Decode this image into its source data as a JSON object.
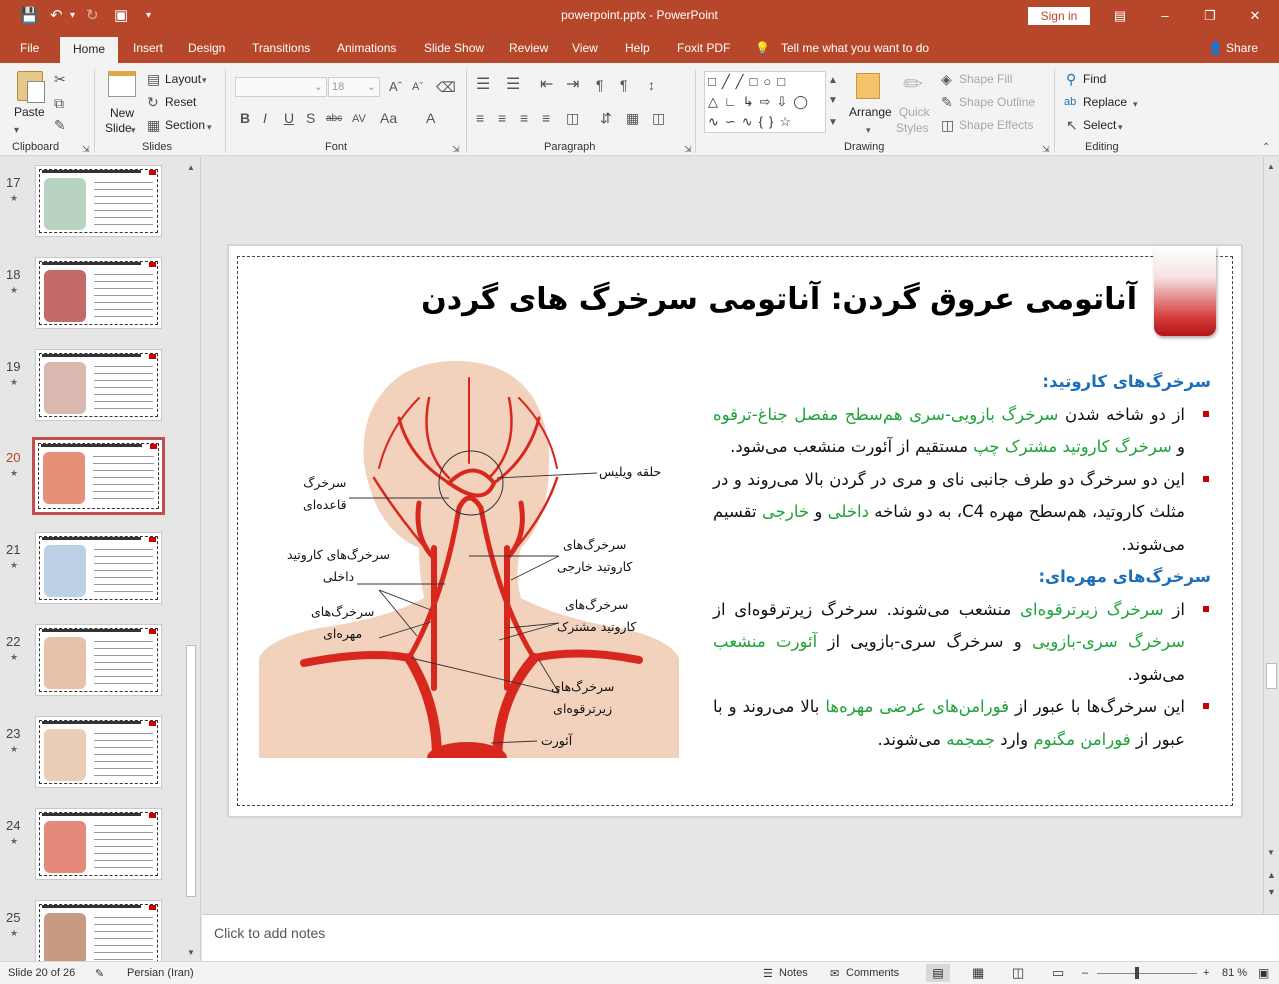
{
  "app": {
    "doc_title": "powerpoint.pptx  -  PowerPoint",
    "signin": "Sign in"
  },
  "menu": [
    "File",
    "Home",
    "Insert",
    "Design",
    "Transitions",
    "Animations",
    "Slide Show",
    "Review",
    "View",
    "Help",
    "Foxit PDF"
  ],
  "tell_me": "Tell me what you want to do",
  "share": "Share",
  "ribbon": {
    "clipboard": {
      "label": "Clipboard",
      "paste": "Paste"
    },
    "slides": {
      "label": "Slides",
      "new_slide_1": "New",
      "new_slide_2": "Slide",
      "layout": "Layout",
      "reset": "Reset",
      "section": "Section"
    },
    "font": {
      "label": "Font",
      "size": "18"
    },
    "paragraph": {
      "label": "Paragraph"
    },
    "drawing": {
      "label": "Drawing",
      "arrange": "Arrange",
      "quick_styles_1": "Quick",
      "quick_styles_2": "Styles",
      "shape_fill": "Shape Fill",
      "shape_outline": "Shape Outline",
      "shape_effects": "Shape Effects"
    },
    "editing": {
      "label": "Editing",
      "find": "Find",
      "replace": "Replace",
      "select": "Select"
    }
  },
  "thumbnails": [
    {
      "num": "17"
    },
    {
      "num": "18"
    },
    {
      "num": "19"
    },
    {
      "num": "20",
      "active": true
    },
    {
      "num": "21"
    },
    {
      "num": "22"
    },
    {
      "num": "23"
    },
    {
      "num": "24"
    },
    {
      "num": "25"
    }
  ],
  "slide": {
    "title": "آناتومی عروق گردن: آناتومی سرخرگ های گردن",
    "heading1": "سرخرگ‌های کاروتید:",
    "heading2": "سرخرگ‌های مهره‌ای:",
    "p1": {
      "a": "از دو شاخه شدن ",
      "b": "سرخرگ بازویی-سری هم‌سطح مفصل جناغ-ترقوه",
      "c": " و ",
      "d": "سرخرگ کاروتید مشترک چپ",
      "e": " مستقیم از آئورت منشعب می‌شود."
    },
    "p2": {
      "a": "این دو سرخرگ دو طرف جانبی نای و مری در گردن بالا می‌روند و در مثلث کاروتید، هم‌سطح مهره C4، به دو شاخه ",
      "b": "داخلی",
      "c": " و ",
      "d": "خارجی",
      "e": " تقسیم می‌شوند."
    },
    "p3": {
      "a": "از ",
      "b": "سرخرگ زیرترقوه‌ای",
      "c": " منشعب می‌شوند. سرخرگ زیرترقوه‌ای از ",
      "d": "سرخرگ سری-بازویی",
      "e": " و سرخرگ سری-بازویی از ",
      "f": "آئورت منشعب",
      "g": " می‌شود."
    },
    "p4": {
      "a": "این سرخرگ‌ها با عبور از ",
      "b": "فورامن‌های عرضی مهره‌ها",
      "c": " بالا می‌روند و با عبور از ",
      "d": "فورامن مگنوم",
      "e": " وارد ",
      "f": "جمجمه",
      "g": " می‌شوند."
    },
    "figure_labels": {
      "willis": "حلقه ویلیس",
      "basilar": "سرخرگ\nقاعده‌ای",
      "int_carotid": "سرخرگ‌های کاروتید\nداخلی",
      "ext_carotid": "سرخرگ‌های\nکاروتید خارجی",
      "vertebral": "سرخرگ‌های\nمهره‌ای",
      "common_carotid": "سرخرگ‌های\nکاروتید مشترک",
      "subclavian": "سرخرگ‌های\nزیرترقوه‌ای",
      "aorta": "آئورت"
    }
  },
  "notes_placeholder": "Click to add notes",
  "status": {
    "slide": "Slide 20 of 26",
    "language": "Persian (Iran)",
    "notes": "Notes",
    "comments": "Comments",
    "zoom": "81 %"
  },
  "colors": {
    "accent": "#b7472a",
    "subheading": "#1f6fb8",
    "highlight": "#1ea33a",
    "bullet": "#cc0000",
    "artery": "#d8281e"
  }
}
